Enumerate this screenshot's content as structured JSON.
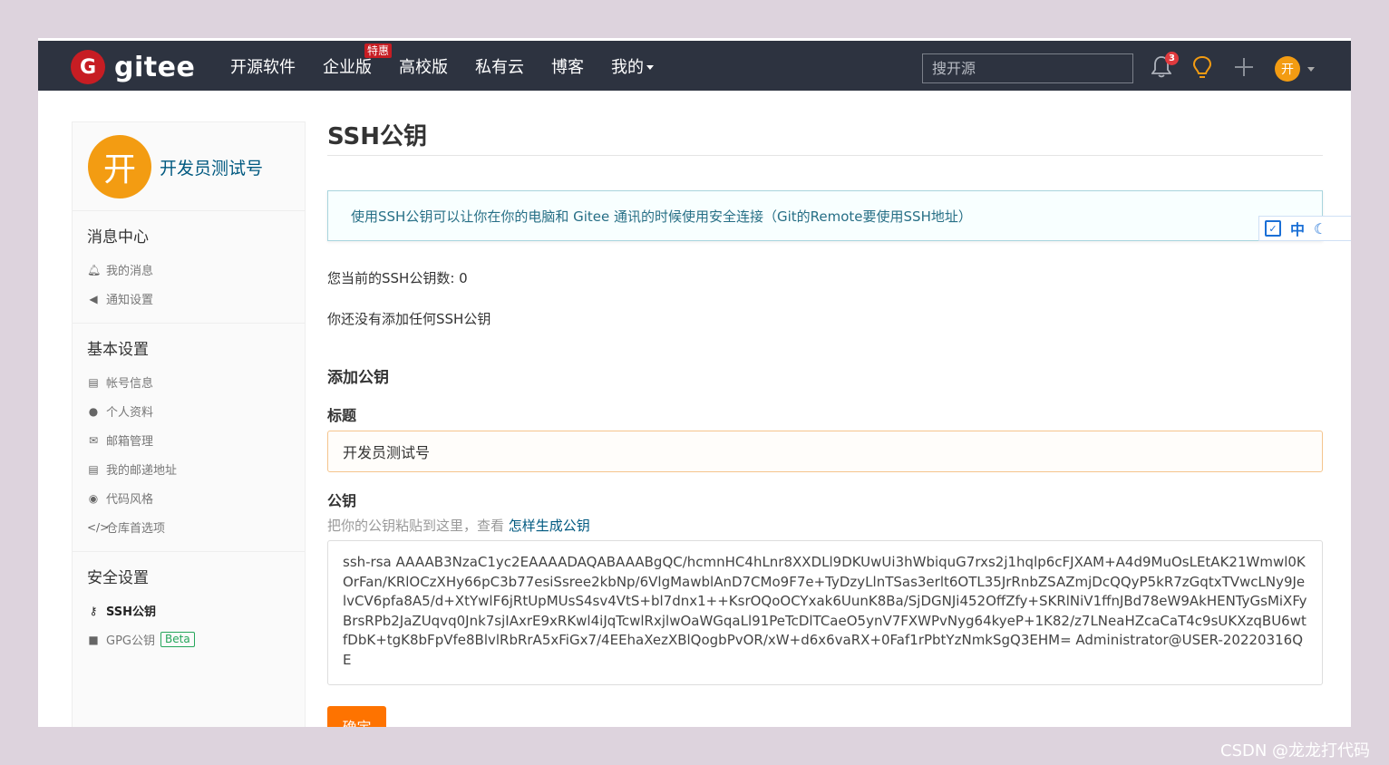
{
  "navbar": {
    "logo_mark": "G",
    "logo_text": "gitee",
    "items": [
      {
        "label": "开源软件"
      },
      {
        "label": "企业版",
        "badge": "特惠"
      },
      {
        "label": "高校版"
      },
      {
        "label": "私有云"
      },
      {
        "label": "博客"
      },
      {
        "label": "我的"
      }
    ],
    "search_placeholder": "搜开源",
    "notification_count": "3",
    "avatar_initial": "开"
  },
  "sidebar": {
    "avatar_initial": "开",
    "username": "开发员测试号",
    "sections": [
      {
        "heading": "消息中心",
        "items": [
          {
            "label": "我的消息",
            "icon": "bell-icon"
          },
          {
            "label": "通知设置",
            "icon": "volume-icon"
          }
        ]
      },
      {
        "heading": "基本设置",
        "items": [
          {
            "label": "帐号信息",
            "icon": "id-card-icon"
          },
          {
            "label": "个人资料",
            "icon": "user-icon"
          },
          {
            "label": "邮箱管理",
            "icon": "envelope-icon"
          },
          {
            "label": "我的邮递地址",
            "icon": "address-card-icon"
          },
          {
            "label": "代码风格",
            "icon": "palette-icon"
          },
          {
            "label": "仓库首选项",
            "icon": "code-icon"
          }
        ]
      },
      {
        "heading": "安全设置",
        "items": [
          {
            "label": "SSH公钥",
            "icon": "key-icon",
            "active": true
          },
          {
            "label": "GPG公钥",
            "icon": "lock-icon",
            "badge": "Beta"
          }
        ]
      }
    ]
  },
  "main": {
    "title": "SSH公钥",
    "info": "使用SSH公钥可以让你在你的电脑和 Gitee 通讯的时候使用安全连接（Git的Remote要使用SSH地址）",
    "count_text": "您当前的SSH公钥数: 0",
    "empty_text": "你还没有添加任何SSH公钥",
    "add_title": "添加公钥",
    "title_label": "标题",
    "title_value": "开发员测试号",
    "key_label": "公钥",
    "key_hint": "把你的公钥粘贴到这里，查看 ",
    "key_hint_link": "怎样生成公钥",
    "key_value": "ssh-rsa AAAAB3NzaC1yc2EAAAADAQABAAABgQC/hcmnHC4hLnr8XXDLl9DKUwUi3hWbiquG7rxs2j1hqlp6cFJXAM+A4d9MuOsLEtAK21Wmwl0KOrFan/KRlOCzXHy66pC3b77esiSsree2kbNp/6VlgMawblAnD7CMo9F7e+TyDzyLlnTSas3erlt6OTL35JrRnbZSAZmjDcQQyP5kR7zGqtxTVwcLNy9JelvCV6pfa8A5/d+XtYwlF6jRtUpMUsS4sv4VtS+bl7dnx1++KsrOQoOCYxak6UunK8Ba/SjDGNJi452OffZfy+SKRlNiV1ffnJBd78eW9AkHENTyGsMiXFyBrsRPb2JaZUqvq0Jnk7sjIAxrE9xRKwl4iJqTcwlRxjlwOaWGqaLl91PeTcDlTCaeO5ynV7FXWPvNyg64kyeP+1K82/z7LNeaHZcaCaT4c9sUKXzqBU6wtfDbK+tgK8bFpVfe8BlvlRbRrA5xFiGx7/4EEhaXezXBlQogbPvOR/xW+d6x6vaRX+0Faf1rPbtYzNmkSgQ3EHM= Administrator@USER-20220316QE",
    "submit_label": "确定"
  },
  "ime": {
    "lang": "中"
  },
  "watermark": "CSDN @龙龙打代码"
}
